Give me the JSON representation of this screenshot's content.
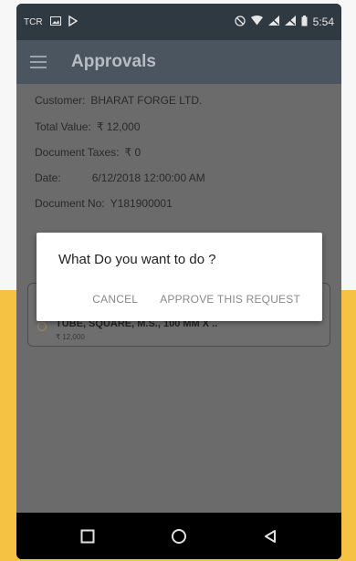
{
  "status_bar": {
    "left_text": "TCR",
    "time": "5:54"
  },
  "app_bar": {
    "title": "Approvals"
  },
  "details": {
    "customer_label": "Customer:",
    "customer_value": "BHARAT FORGE LTD.",
    "total_label": "Total Value:",
    "total_value": "₹ 12,000",
    "taxes_label": "Document Taxes:",
    "taxes_value": "₹ 0",
    "date_label": "Date:",
    "date_value": "6/12/2018 12:00:00 AM",
    "docno_label": "Document No:",
    "docno_value": "Y181900001"
  },
  "item": {
    "name": "TUBE, SQUARE, M.S., 100 MM X ..",
    "amount": "₹ 12,000"
  },
  "dialog": {
    "title": "What Do you want to do ?",
    "cancel_label": "CANCEL",
    "approve_label": "APPROVE THIS REQUEST"
  },
  "nav": {
    "icons": [
      "recents-icon",
      "home-icon",
      "back-icon"
    ]
  },
  "colors": {
    "accent": "#f6c243",
    "status_bar": "#2f3942",
    "app_bar": "#4a5560",
    "scrim_content": "#6b6b6b"
  }
}
